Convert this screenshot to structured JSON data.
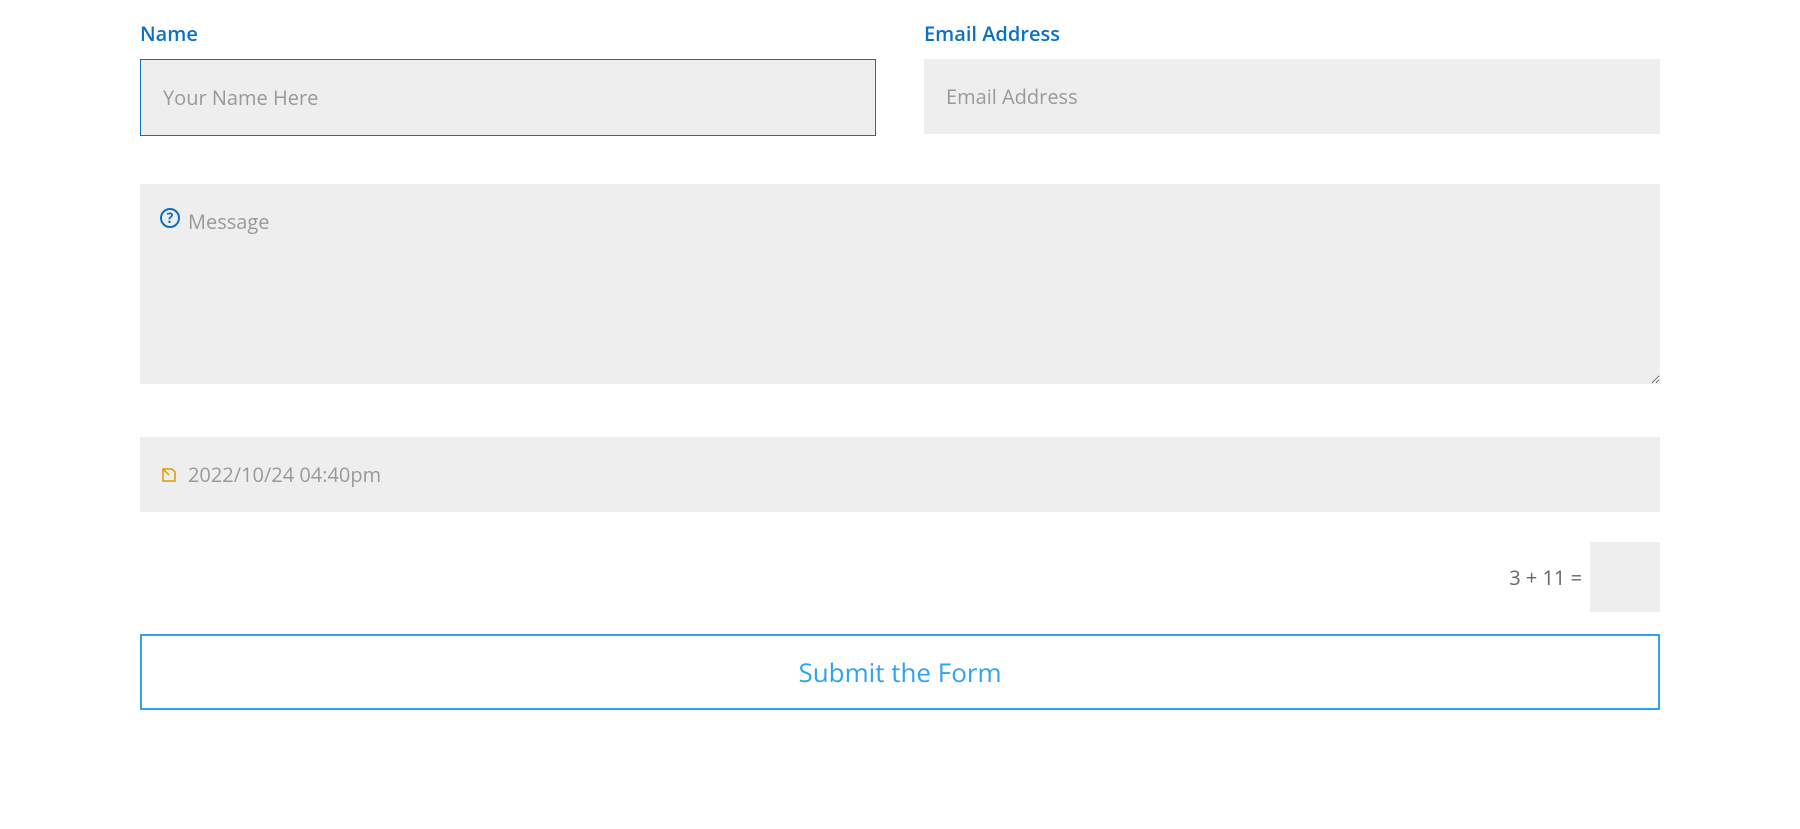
{
  "form": {
    "name": {
      "label": "Name",
      "placeholder": "Your Name Here",
      "value": ""
    },
    "email": {
      "label": "Email Address",
      "placeholder": "Email Address",
      "value": ""
    },
    "message": {
      "placeholder": "Message",
      "value": ""
    },
    "datetime": {
      "value": "2022/10/24 04:40pm"
    },
    "captcha": {
      "question": "3 + 11 =",
      "value": ""
    },
    "submit": {
      "label": "Submit the Form"
    }
  }
}
